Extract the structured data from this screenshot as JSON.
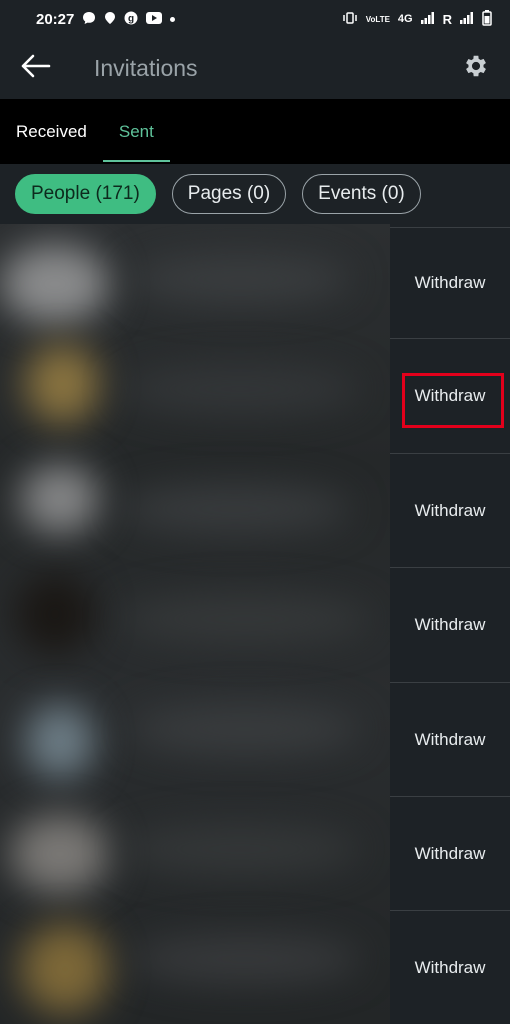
{
  "status_bar": {
    "time": "20:27",
    "network_label": "4G",
    "carrier_label": "R",
    "volte_label": "VoLTE"
  },
  "app_bar": {
    "title": "Invitations"
  },
  "tabs": [
    {
      "label": "Received",
      "active": false
    },
    {
      "label": "Sent",
      "active": true
    }
  ],
  "filters": [
    {
      "label": "People (171)",
      "active": true
    },
    {
      "label": "Pages (0)",
      "active": false
    },
    {
      "label": "Events (0)",
      "active": false
    }
  ],
  "rows": [
    {
      "action_label": "Withdraw"
    },
    {
      "action_label": "Withdraw"
    },
    {
      "action_label": "Withdraw"
    },
    {
      "action_label": "Withdraw"
    },
    {
      "action_label": "Withdraw"
    },
    {
      "action_label": "Withdraw"
    },
    {
      "action_label": "Withdraw"
    }
  ],
  "colors": {
    "accent": "#5fc39b",
    "chip_active": "#3fbd82",
    "highlight": "#e3001b",
    "background": "#1d2226"
  }
}
